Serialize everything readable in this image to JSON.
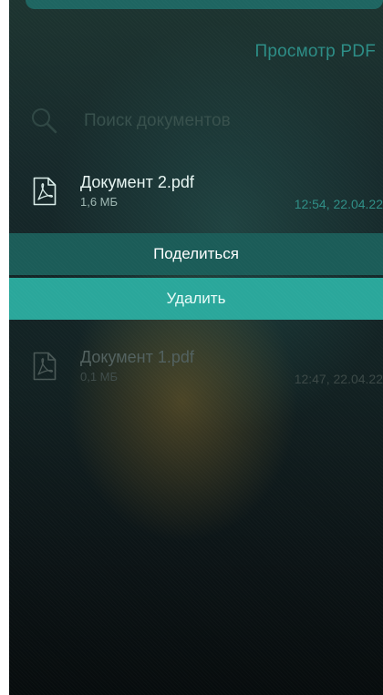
{
  "header": {
    "title": "Просмотр PDF"
  },
  "search": {
    "placeholder": "Поиск документов"
  },
  "documents": [
    {
      "name": "Документ 2.pdf",
      "size": "1,6 МБ",
      "date": "12:54, 22.04.22"
    },
    {
      "name": "Документ 1.pdf",
      "size": "0,1 МБ",
      "date": "12:47, 22.04.22"
    }
  ],
  "actions": {
    "share_label": "Поделиться",
    "delete_label": "Удалить"
  },
  "colors": {
    "accent": "#2aa79b",
    "accent_dark": "#1b5c58",
    "title": "#2c8d86"
  }
}
